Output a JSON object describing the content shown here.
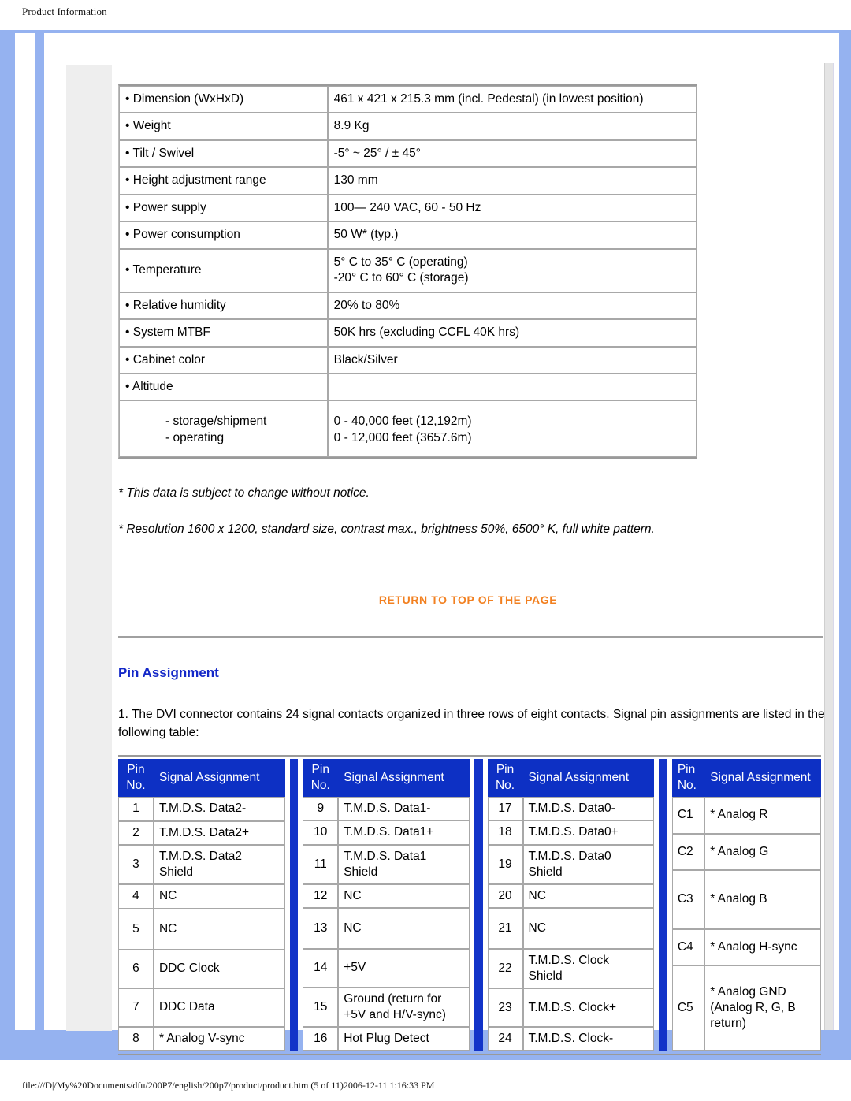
{
  "header": {
    "title": "Product Information"
  },
  "colors": {
    "frame_blue": "#95b2f0",
    "table_header_blue": "#0D30C4",
    "divider_blue": "#1233C8",
    "link_orange": "#F28020",
    "section_title_blue": "#1428C8"
  },
  "spec_table": {
    "rows": [
      {
        "key": "• Dimension (WxHxD)",
        "value": "461 x 421 x 215.3 mm (incl. Pedestal) (in lowest position)"
      },
      {
        "key": "• Weight",
        "value": "8.9 Kg"
      },
      {
        "key": "• Tilt / Swivel",
        "value": "-5° ~ 25° / ± 45°"
      },
      {
        "key": "• Height adjustment range",
        "value": "130 mm"
      },
      {
        "key": "• Power supply",
        "value": "100— 240 VAC, 60 - 50 Hz"
      },
      {
        "key": "• Power consumption",
        "value": "50 W* (typ.)"
      },
      {
        "key": "• Temperature",
        "value": "5° C to 35° C (operating)\n-20° C to 60° C (storage)"
      },
      {
        "key": "• Relative humidity",
        "value": "20% to 80%"
      },
      {
        "key": "• System MTBF",
        "value": "50K hrs (excluding CCFL 40K hrs)"
      },
      {
        "key": "• Cabinet color",
        "value": "Black/Silver"
      },
      {
        "key": "• Altitude",
        "value": ""
      },
      {
        "key": "- storage/shipment\n- operating",
        "value": "0 - 40,000 feet (12,192m)\n0 - 12,000 feet (3657.6m)"
      }
    ]
  },
  "notes": {
    "note1": "* This data is subject to change without notice.",
    "note2": "* Resolution 1600 x 1200, standard size, contrast max., brightness 50%, 6500° K, full white pattern."
  },
  "return_link": {
    "label": "RETURN TO TOP OF THE PAGE"
  },
  "pin_section": {
    "title": "Pin Assignment",
    "intro": "1. The DVI connector contains 24 signal contacts organized in three rows of eight contacts. Signal pin assignments are listed in the following table:",
    "column_headers": {
      "pin_no": "Pin\nNo.",
      "signal": "Signal Assignment"
    },
    "groups": [
      {
        "rows": [
          {
            "pin": "1",
            "signal": "T.M.D.S. Data2-",
            "h": "h1"
          },
          {
            "pin": "2",
            "signal": "T.M.D.S. Data2+",
            "h": "h1"
          },
          {
            "pin": "3",
            "signal": "T.M.D.S. Data2\nShield",
            "h": "h2"
          },
          {
            "pin": "4",
            "signal": "NC",
            "h": "h1"
          },
          {
            "pin": "5",
            "signal": "NC",
            "h": "h3"
          },
          {
            "pin": "6",
            "signal": "DDC Clock",
            "h": "h4"
          },
          {
            "pin": "7",
            "signal": "DDC Data",
            "h": "h4"
          },
          {
            "pin": "8",
            "signal": "* Analog V-sync",
            "h": "h1"
          }
        ]
      },
      {
        "rows": [
          {
            "pin": "9",
            "signal": "T.M.D.S. Data1-",
            "h": "h1"
          },
          {
            "pin": "10",
            "signal": "T.M.D.S. Data1+",
            "h": "h1"
          },
          {
            "pin": "11",
            "signal": "T.M.D.S. Data1\nShield",
            "h": "h2"
          },
          {
            "pin": "12",
            "signal": "NC",
            "h": "h1"
          },
          {
            "pin": "13",
            "signal": "NC",
            "h": "h3"
          },
          {
            "pin": "14",
            "signal": "+5V",
            "h": "h4"
          },
          {
            "pin": "15",
            "signal": "Ground (return for\n+5V and H/V-sync)",
            "h": "h4"
          },
          {
            "pin": "16",
            "signal": "Hot Plug Detect",
            "h": "h1"
          }
        ]
      },
      {
        "rows": [
          {
            "pin": "17",
            "signal": "T.M.D.S. Data0-",
            "h": "h1"
          },
          {
            "pin": "18",
            "signal": "T.M.D.S. Data0+",
            "h": "h1"
          },
          {
            "pin": "19",
            "signal": "T.M.D.S. Data0\nShield",
            "h": "h2"
          },
          {
            "pin": "20",
            "signal": "NC",
            "h": "h1"
          },
          {
            "pin": "21",
            "signal": "NC",
            "h": "h3"
          },
          {
            "pin": "22",
            "signal": "T.M.D.S. Clock\nShield",
            "h": "h2"
          },
          {
            "pin": "23",
            "signal": "T.M.D.S. Clock+",
            "h": "h4"
          },
          {
            "pin": "24",
            "signal": "T.M.D.S. Clock-",
            "h": "h1"
          }
        ]
      },
      {
        "rows": [
          {
            "pin": "C1",
            "signal": "* Analog R",
            "h": "h1"
          },
          {
            "pin": "C2",
            "signal": "* Analog G",
            "h": "h1"
          },
          {
            "pin": "C3",
            "signal": "* Analog B",
            "h": "h4"
          },
          {
            "pin": "C4",
            "signal": "* Analog H-sync",
            "h": "h1"
          },
          {
            "pin": "C5",
            "signal": "* Analog GND\n(Analog R, G, B\nreturn)",
            "h": "h5"
          }
        ]
      }
    ]
  },
  "footer": {
    "url": "file:///D|/My%20Documents/dfu/200P7/english/200p7/product/product.htm (5 of 11)2006-12-11 1:16:33 PM"
  }
}
